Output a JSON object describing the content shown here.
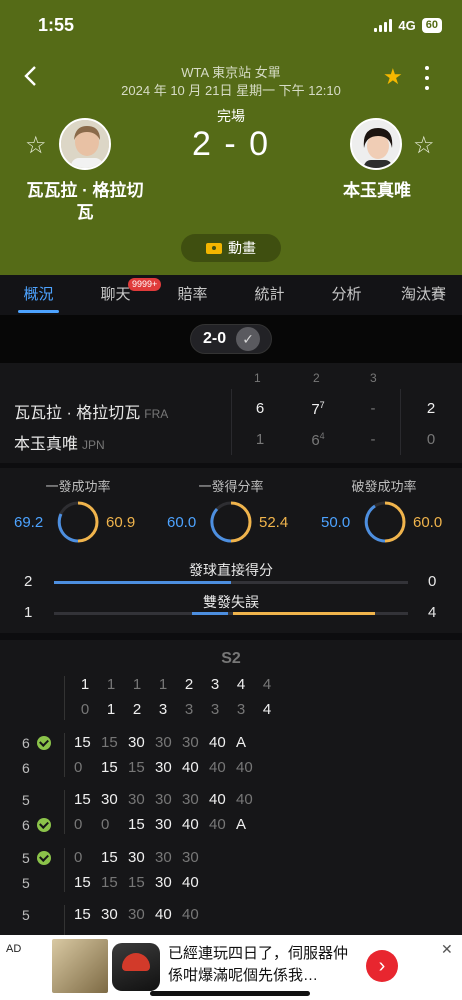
{
  "status_bar": {
    "time": "1:55",
    "network": "4G",
    "battery": "60"
  },
  "header": {
    "event": "WTA 東京站 女單",
    "datetime": "2024 年 10 月 21日 星期一 下午 12:10",
    "status": "完場",
    "score": "2 - 0",
    "animation_label": "動畫",
    "favorite_color": "#f5b800"
  },
  "players": [
    {
      "name": "瓦瓦拉 · 格拉切瓦",
      "short": "瓦瓦拉 · 格拉切瓦",
      "country": "FRA"
    },
    {
      "name": "本玉真唯",
      "short": "本玉真唯",
      "country": "JPN"
    }
  ],
  "tabs": [
    {
      "label": "概況",
      "active": true
    },
    {
      "label": "聊天",
      "badge": "9999+"
    },
    {
      "label": "賠率"
    },
    {
      "label": "統計"
    },
    {
      "label": "分析"
    },
    {
      "label": "淘汰賽"
    }
  ],
  "set_summary": {
    "score": "2-0"
  },
  "scoreboard": {
    "set_headers": [
      "1",
      "2",
      "3"
    ],
    "rows": [
      {
        "s1": "6",
        "s2": "7",
        "s2_tb": "7",
        "s3": "-",
        "sets": "2"
      },
      {
        "s1": "1",
        "s2": "6",
        "s2_tb": "4",
        "s3": "-",
        "sets": "0"
      }
    ]
  },
  "stats": {
    "rings": [
      {
        "title": "一發成功率",
        "left": "69.2",
        "right": "60.9"
      },
      {
        "title": "一發得分率",
        "left": "60.0",
        "right": "52.4"
      },
      {
        "title": "破發成功率",
        "left": "50.0",
        "right": "60.0"
      }
    ],
    "bars": [
      {
        "title": "發球直接得分",
        "left": "2",
        "right": "0"
      },
      {
        "title": "雙發失誤",
        "left": "1",
        "right": "4"
      }
    ]
  },
  "point_by_point": {
    "set_label": "S2",
    "games_top": [
      "1",
      "1",
      "1",
      "1",
      "2",
      "3",
      "4",
      "4"
    ],
    "games_bottom": [
      "0",
      "1",
      "2",
      "3",
      "3",
      "3",
      "3",
      "4"
    ],
    "blocks": [
      {
        "score_top": "6",
        "score_bottom": "6",
        "server": "top",
        "top": [
          "15",
          "15",
          "30",
          "30",
          "30",
          "40",
          "A"
        ],
        "bottom": [
          "0",
          "15",
          "15",
          "30",
          "40",
          "40",
          "40"
        ]
      },
      {
        "score_top": "5",
        "score_bottom": "6",
        "server": "bottom",
        "top": [
          "15",
          "30",
          "30",
          "30",
          "30",
          "40",
          "40"
        ],
        "bottom": [
          "0",
          "0",
          "15",
          "30",
          "40",
          "40",
          "A"
        ]
      },
      {
        "score_top": "5",
        "score_bottom": "5",
        "server": "top",
        "top": [
          "0",
          "15",
          "30",
          "30",
          "30"
        ],
        "bottom": [
          "15",
          "15",
          "15",
          "30",
          "40"
        ]
      },
      {
        "score_top": "5",
        "score_bottom": "",
        "server": "bottom",
        "top": [
          "15",
          "30",
          "30",
          "40",
          "40"
        ],
        "bottom": []
      }
    ]
  },
  "ad": {
    "label": "AD",
    "text": "已經連玩四日了，伺服器仲係咁爆滿呢個先係我…",
    "close": "✕"
  }
}
